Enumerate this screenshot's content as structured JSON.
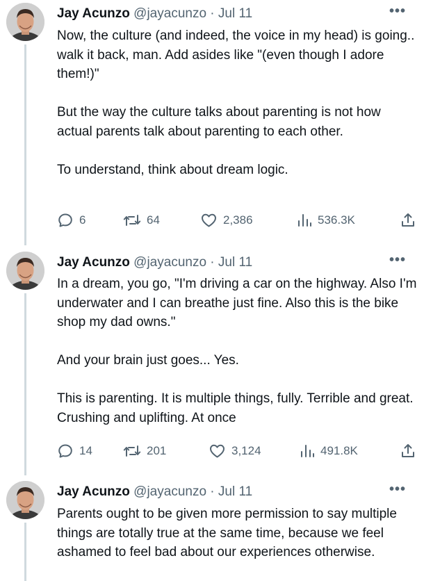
{
  "tweets": [
    {
      "author_name": "Jay Acunzo",
      "handle": "@jayacunzo",
      "date": "Jul 11",
      "separator": "·",
      "paragraphs": [
        "Now, the culture (and indeed, the voice in my head) is going.. walk it back, man. Add asides like \"(even though I adore them!)\"",
        "But the way the culture talks about parenting is not how actual parents talk about parenting to each other.",
        "To understand, think about dream logic."
      ],
      "replies": "6",
      "retweets": "64",
      "likes": "2,386",
      "views": "536.3K"
    },
    {
      "author_name": "Jay Acunzo",
      "handle": "@jayacunzo",
      "date": "Jul 11",
      "separator": "·",
      "paragraphs": [
        "In a dream, you go, \"I'm driving a car on the highway. Also I'm underwater and I can breathe just fine. Also this is the bike shop my dad owns.\"",
        "And your brain just goes... Yes.",
        "This is parenting. It is multiple things, fully. Terrible and great. Crushing and uplifting. At once"
      ],
      "replies": "14",
      "retweets": "201",
      "likes": "3,124",
      "views": "491.8K"
    },
    {
      "author_name": "Jay Acunzo",
      "handle": "@jayacunzo",
      "date": "Jul 11",
      "separator": "·",
      "paragraphs": [
        "Parents ought to be given more permission to say multiple things are totally true at the same time, because we feel ashamed to feel bad about our experiences otherwise."
      ]
    }
  ],
  "icons": {
    "more": "more-horizontal-icon",
    "reply": "reply-icon",
    "retweet": "retweet-icon",
    "like": "heart-icon",
    "views": "views-chart-icon",
    "share": "share-icon"
  },
  "colors": {
    "text": "#0f1419",
    "secondary": "#536471",
    "thread_line": "#cfd9de"
  }
}
